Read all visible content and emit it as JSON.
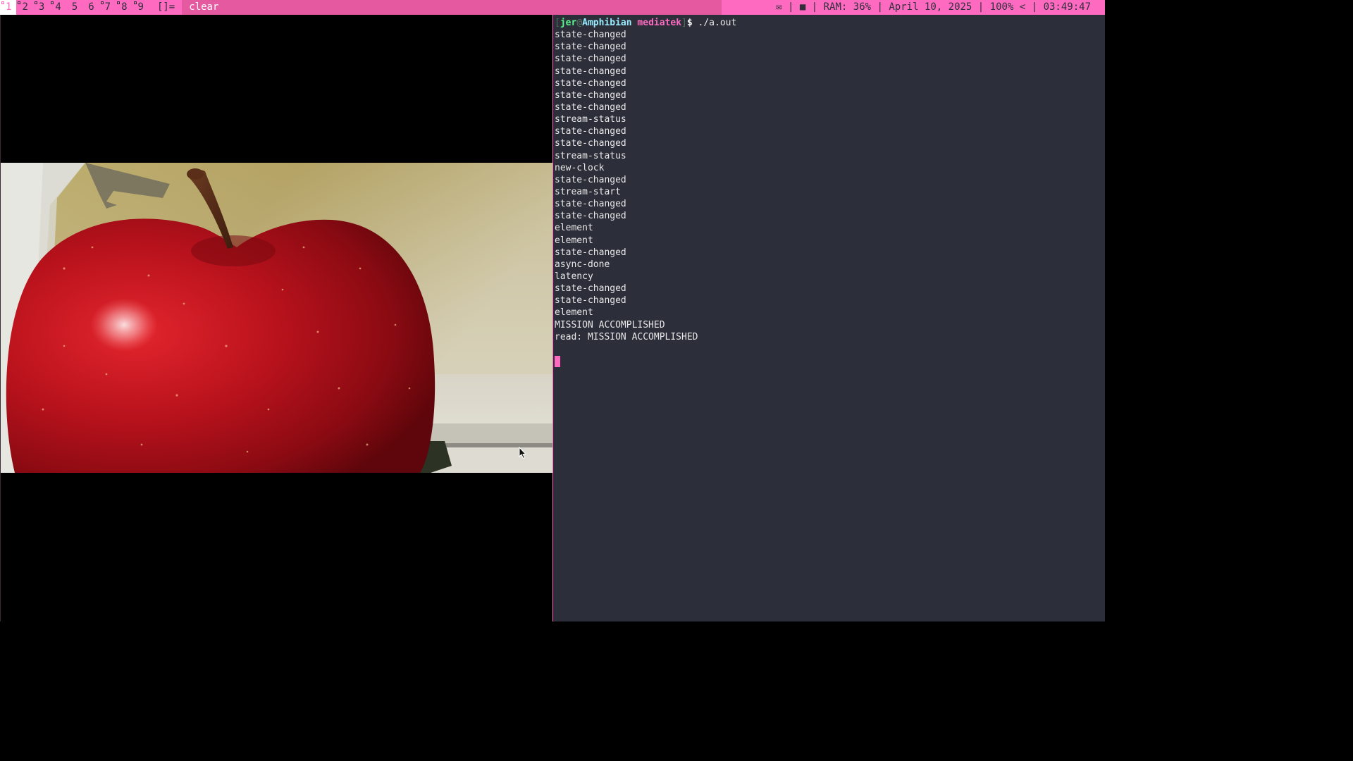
{
  "topbar": {
    "tags": [
      {
        "label": "1",
        "selected": true,
        "occupied": true
      },
      {
        "label": "2",
        "selected": false,
        "occupied": true
      },
      {
        "label": "3",
        "selected": false,
        "occupied": true
      },
      {
        "label": "4",
        "selected": false,
        "occupied": true
      },
      {
        "label": "5",
        "selected": false,
        "occupied": false
      },
      {
        "label": "6",
        "selected": false,
        "occupied": false
      },
      {
        "label": "7",
        "selected": false,
        "occupied": true
      },
      {
        "label": "8",
        "selected": false,
        "occupied": true
      },
      {
        "label": "9",
        "selected": false,
        "occupied": true
      }
    ],
    "layout_symbol": "[]=",
    "window_title": "clear",
    "status": {
      "mail_icon": "✉",
      "stop_icon": "■",
      "ram": "RAM: 36%",
      "date": "April 10, 2025",
      "volume": "100%",
      "chevron": "<",
      "time": "03:49:47"
    },
    "colors": {
      "bar": "#ff6ac1",
      "title_bg": "#e4599f",
      "selected_tag_bg": "#ffffff"
    }
  },
  "video": {
    "content": "video-frame-red-apple"
  },
  "terminal": {
    "prompt": {
      "open": "[",
      "user": "jer",
      "at": "@",
      "host": "Amphibian",
      "dir": "mediatek",
      "close": "]",
      "dollar": "$",
      "command": "./a.out"
    },
    "output": [
      "state-changed",
      "state-changed",
      "state-changed",
      "state-changed",
      "state-changed",
      "state-changed",
      "state-changed",
      "stream-status",
      "state-changed",
      "state-changed",
      "stream-status",
      "new-clock",
      "state-changed",
      "stream-start",
      "state-changed",
      "state-changed",
      "element",
      "element",
      "state-changed",
      "async-done",
      "latency",
      "state-changed",
      "state-changed",
      "element",
      "MISSION ACCOMPLISHED",
      "read: MISSION ACCOMPLISHED",
      ""
    ],
    "colors": {
      "background": "#2c2e3a",
      "cursor": "#ff6ac1",
      "text": "#e8e8e8"
    }
  }
}
